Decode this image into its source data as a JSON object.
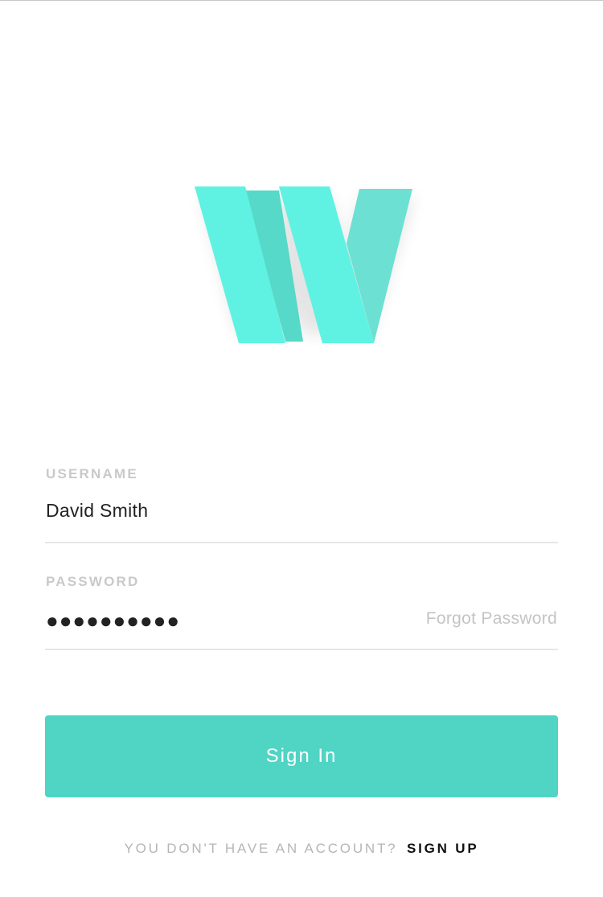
{
  "login": {
    "username_label": "USERNAME",
    "username_value": "David Smith",
    "password_label": "PASSWORD",
    "password_value": "●●●●●●●●●●",
    "forgot_password": "Forgot Password",
    "signin_label": "Sign In",
    "signup_question": "YOU DON'T HAVE AN ACCOUNT?",
    "signup_link": "SIGN UP"
  },
  "theme": {
    "accent": "#50d4c4",
    "logo_primary": "#5ff2e2",
    "logo_shadow": "#56d9c8",
    "logo_side": "#6ce0d2"
  },
  "icons": {
    "logo": "w-logo-icon"
  }
}
